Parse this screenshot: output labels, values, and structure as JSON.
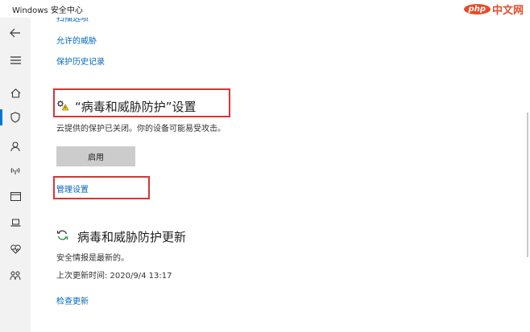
{
  "window": {
    "title": "Windows 安全中心"
  },
  "watermark": {
    "badge": "php",
    "text": "中文网"
  },
  "links": {
    "scan_options": "扫描选项",
    "allowed_threats": "允许的威胁",
    "protection_history": "保护历史记录",
    "manage_settings": "管理设置",
    "check_updates": "检查更新"
  },
  "settings_section": {
    "title": "“病毒和威胁防护”设置",
    "status": "云提供的保护已关闭。你的设备可能易受攻击。",
    "enable_button": "启用"
  },
  "updates_section": {
    "title": "病毒和威胁防护更新",
    "status": "安全情报是最新的。",
    "last_update": "上次更新时间: 2020/9/4 13:17"
  },
  "colors": {
    "link": "#0067c0",
    "highlight": "#d93535",
    "accent": "#0078d4",
    "warning": "#f5c400"
  }
}
